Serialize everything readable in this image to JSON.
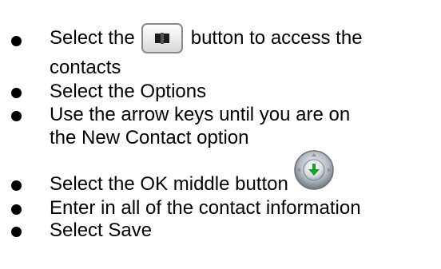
{
  "steps": [
    {
      "before_icon": "Select the",
      "icon": "contacts-book-icon",
      "after_icon": "button to access the",
      "line2": "contacts"
    },
    {
      "line1": "Select the Options"
    },
    {
      "line1": "Use the arrow keys until you are on",
      "line2": "the New Contact option"
    },
    {
      "line1": "Select the OK middle button",
      "icon": "ok-middle-button-icon"
    },
    {
      "line1": "Enter in all of the contact information"
    },
    {
      "line1": "Select Save"
    }
  ]
}
